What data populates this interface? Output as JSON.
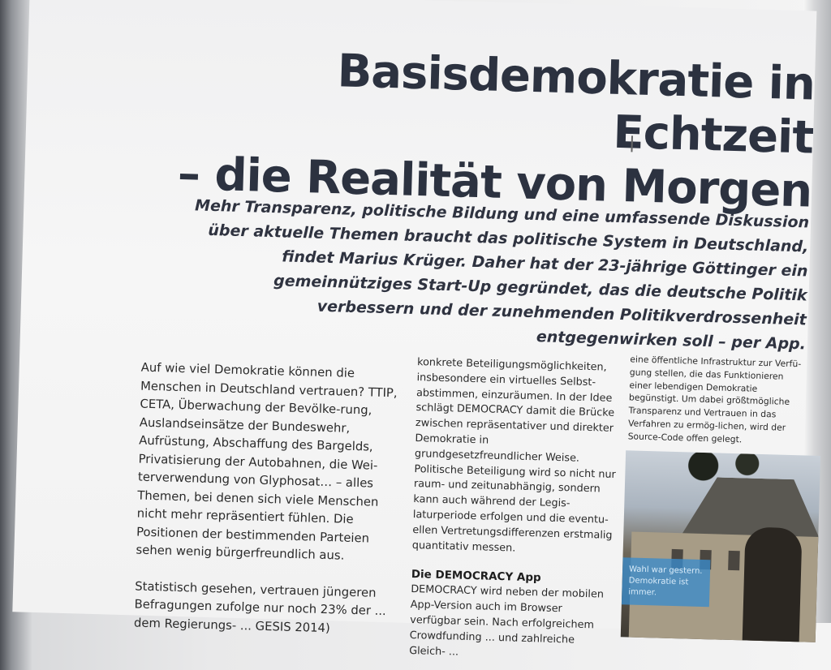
{
  "article": {
    "headline_line1": "Basisdemokratie in Echtzeit",
    "headline_line2": "– die Realität von Morgen",
    "lead": "Mehr Transparenz, politische Bildung und eine umfassende Diskussion über aktuelle Themen braucht das politische System in Deutschland, findet Marius Krüger. Daher hat der 23-jährige Göttinger ein gemeinnütziges Start-Up gegründet, das die deutsche Politik verbessern und der zunehmenden Politikverdrossenheit entgegenwirken soll – per App.",
    "col1_p1": "Auf wie viel Demokratie können die Menschen in Deutschland vertrauen? TTIP, CETA, Überwachung der Bevölke-rung, Auslandseinsätze der Bundeswehr, Aufrüstung, Abschaffung des Bargelds, Privatisierung der Autobahnen, die Wei-terverwendung von Glyphosat… – alles Themen, bei denen sich viele Menschen nicht mehr repräsentiert fühlen. Die Positionen der bestimmenden Parteien sehen wenig bürgerfreundlich aus.",
    "col1_p2": "Statistisch gesehen, vertrauen jüngeren Befragungen zufolge nur noch 23% der ... dem Regierungs- ... GESIS 2014)",
    "col2_p1": "konkrete Beteiligungsmöglichkeiten, insbesondere ein virtuelles Selbst-abstimmen, einzuräumen. In der Idee schlägt DEMOCRACY damit die Brücke zwischen repräsentativer und direkter Demokratie in grundgesetzfreundlicher Weise. Politische Beteiligung wird so nicht nur raum- und zeitunabhängig, sondern kann auch während der Legis-laturperiode erfolgen und die eventu-ellen Vertretungsdifferenzen erstmalig quantitativ messen.",
    "col2_heading": "Die DEMOCRACY App",
    "col2_p2": "DEMOCRACY wird neben der mobilen App-Version auch im Browser verfügbar sein. Nach erfolgreichem Crowdfunding ... und zahlreiche Gleich- ...",
    "col3_p1": "eine öffentliche Infrastruktur zur Verfü-gung stellen, die das Funktionieren einer lebendigen Demokratie begünstigt. Um dabei größtmögliche Transparenz und Vertrauen in das Verfahren zu ermög-lichen, wird der Source-Code offen gelegt.",
    "photo_caption": "Wahl war gestern. Demokratie ist immer."
  }
}
